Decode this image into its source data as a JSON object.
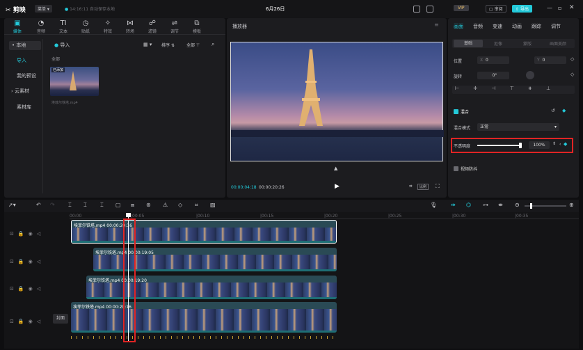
{
  "titlebar": {
    "app_name": "剪映",
    "menu_label": "菜单",
    "autosave": "14:16:11 自动保存本地",
    "date_title": "6月26日",
    "vip_label": "VIP",
    "review_label": "审阅",
    "export_label": "导出"
  },
  "media_toolbar": [
    {
      "label": "媒体",
      "icon": "media-icon"
    },
    {
      "label": "音频",
      "icon": "audio-icon"
    },
    {
      "label": "文本",
      "icon": "text-icon"
    },
    {
      "label": "贴纸",
      "icon": "sticker-icon"
    },
    {
      "label": "特效",
      "icon": "effects-icon"
    },
    {
      "label": "转场",
      "icon": "transition-icon"
    },
    {
      "label": "滤镜",
      "icon": "filter-icon"
    },
    {
      "label": "调节",
      "icon": "adjust-icon"
    },
    {
      "label": "模板",
      "icon": "template-icon"
    }
  ],
  "sidebar": {
    "local": "• 本地",
    "import": "导入",
    "my_presets": "我的预设",
    "cloud": "› 云素材",
    "library": "素材库"
  },
  "media_panel": {
    "import_label": "导入",
    "all_label": "全部",
    "sort_label": "排序",
    "filter_label": "全部",
    "thumb_badge": "已添加",
    "thumb_name": "埃菲尔铁塔.mp4"
  },
  "player": {
    "title": "播放器",
    "current_time": "00:00:04:18",
    "total_time": "00:00:20:26",
    "ratio_label": "比例"
  },
  "props": {
    "tabs": [
      "画面",
      "音频",
      "变速",
      "动画",
      "跟踪",
      "调节"
    ],
    "subtabs": [
      "基础",
      "抠像",
      "蒙版",
      "画面美颜"
    ],
    "position_label": "位置",
    "x_label": "X",
    "x_value": "0",
    "y_label": "Y",
    "y_value": "0",
    "rotate_label": "旋转",
    "rotate_value": "0°",
    "blend_label": "混合",
    "blend_mode_label": "混合模式",
    "blend_mode_value": "正常",
    "opacity_label": "不透明度",
    "opacity_value": "100%",
    "opacity_fraction": 1.0,
    "stabilize_label": "视频防抖"
  },
  "timeline": {
    "ruler": [
      "00:00",
      "|00:05",
      "|00:10",
      "|00:15",
      "|00:20",
      "|00:25",
      "|00:30",
      "|00:35"
    ],
    "cover_label": "封面",
    "clips": [
      {
        "title": "埃菲尔铁塔.mp4  00:00:20:16"
      },
      {
        "title": "埃菲尔铁塔.mp4  00:00:19:05"
      },
      {
        "title": "埃菲尔铁塔.mp4  00:00:19:20"
      },
      {
        "title": "埃菲尔铁塔.mp4  00:00:20:16"
      }
    ]
  },
  "colors": {
    "accent": "#23c9d9",
    "highlight_box": "#e02424",
    "background": "#0e0e10"
  }
}
